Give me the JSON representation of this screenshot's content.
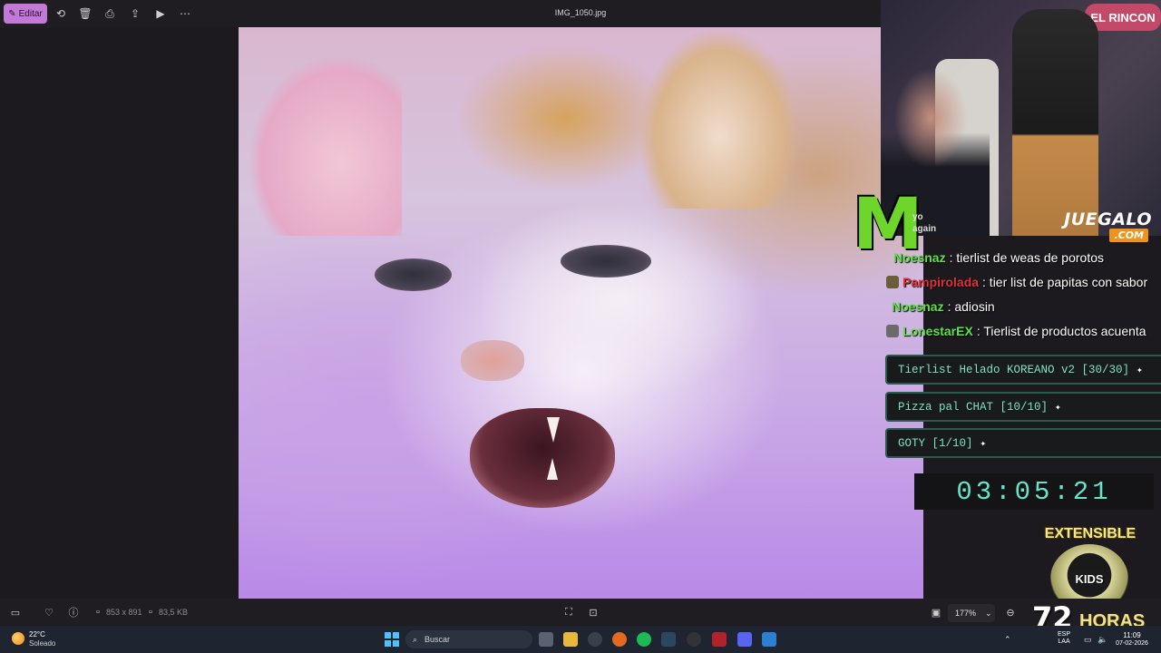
{
  "app": {
    "edit_label": "Editar",
    "file_name": "IMG_1050.jpg"
  },
  "bottom": {
    "dimensions": "853 x 891",
    "file_size": "83,5 KB",
    "zoom": "177%"
  },
  "stream": {
    "cam_sign": "EL RINCON",
    "juegalo_top": "JUEGALO",
    "juegalo_bottom": ".COM",
    "ghost_line_1": "yo",
    "ghost_line_2": "again",
    "chat": [
      {
        "user": "Noesnaz",
        "user_color": "#5fe04a",
        "message": ": tierlist de weas de porotos",
        "badge": false
      },
      {
        "user": "Pampirolada",
        "user_color": "#e0303a",
        "message": ": tier list de papitas con sabor",
        "badge": true
      },
      {
        "user": "Noesnaz",
        "user_color": "#5fe04a",
        "message": ": adiosin",
        "badge": false
      },
      {
        "user": "LonestarEX",
        "user_color": "#5fe04a",
        "message": ": Tierlist de productos acuenta",
        "badge": true
      }
    ],
    "goals": [
      {
        "label": "Tierlist Helado KOREANO v2 [30/30]"
      },
      {
        "label": "Pizza pal CHAT [10/10]"
      },
      {
        "label": "GOTY [1/10]"
      }
    ],
    "timer": "03:05:21",
    "extensible": "EXTENSIBLE",
    "kids_label": "KIDS",
    "hours_number": "72",
    "hours_word": "HORAS"
  },
  "taskbar": {
    "temp": "22°C",
    "weather": "Soleado",
    "search_placeholder": "Buscar",
    "lang_top": "ESP",
    "lang_bottom": "LAA",
    "time": "11:09",
    "date": "07-02-2026"
  },
  "colors": {
    "edit_accent": "#c27ad6",
    "goal_text": "#7fe1c4",
    "timer_text": "#66e3c8"
  }
}
